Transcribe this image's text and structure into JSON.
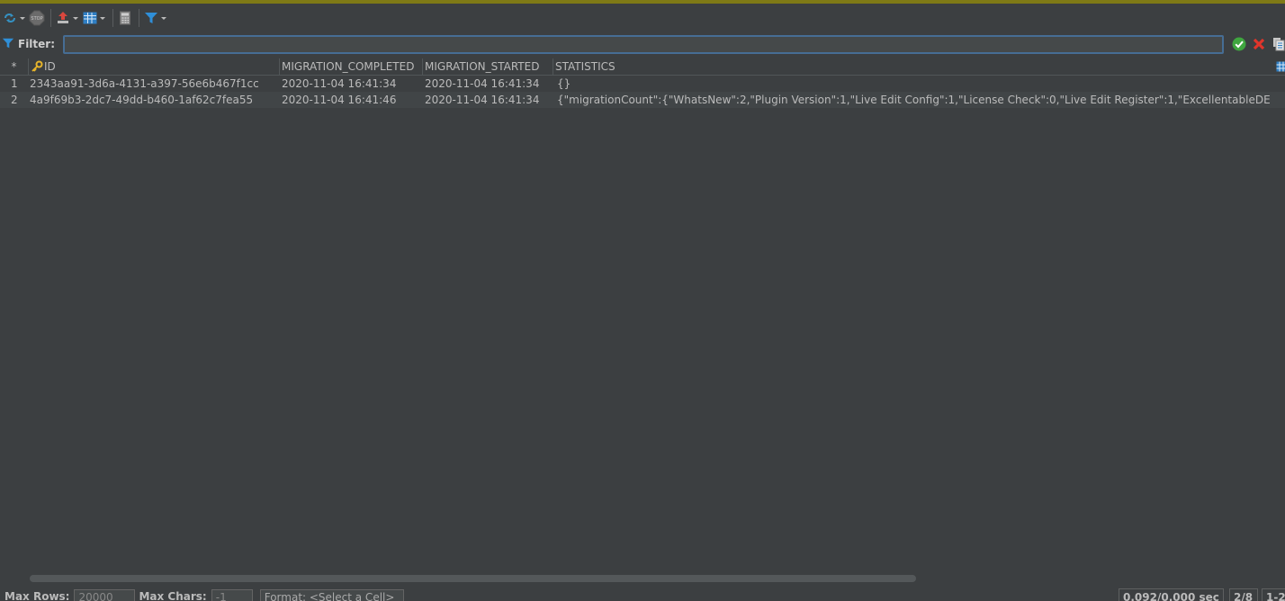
{
  "toolbar": {
    "icons": [
      "refresh-icon",
      "stop-icon",
      "export-icon",
      "grid-icon",
      "calculator-icon",
      "filter-icon"
    ],
    "stop_label": "STOP"
  },
  "filter": {
    "label": "Filter:",
    "value": "",
    "placeholder": ""
  },
  "table": {
    "corner": "*",
    "columns": [
      "ID",
      "MIGRATION_COMPLETED",
      "MIGRATION_STARTED",
      "STATISTICS"
    ],
    "rows": [
      {
        "num": "1",
        "id": "2343aa91-3d6a-4131-a397-56e6b467f1cc",
        "completed": "2020-11-04 16:41:34",
        "started": "2020-11-04 16:41:34",
        "statistics": "{}"
      },
      {
        "num": "2",
        "id": "4a9f69b3-2dc7-49dd-b460-1af62c7fea55",
        "completed": "2020-11-04 16:41:46",
        "started": "2020-11-04 16:41:34",
        "statistics": "{\"migrationCount\":{\"WhatsNew\":2,\"Plugin Version\":1,\"Live Edit Config\":1,\"License Check\":0,\"Live Edit Register\":1,\"ExcellentableDE"
      }
    ]
  },
  "status": {
    "max_rows_label": "Max Rows:",
    "max_rows_value": "20000",
    "max_chars_label": "Max Chars:",
    "max_chars_value": "-1",
    "format_label": "Format: <Select a Cell>",
    "timing": "0.092/0.000 sec",
    "fetched": "2/8",
    "range": "1-2"
  },
  "colors": {
    "accent": "#7f7a16",
    "background": "#3c3f41",
    "input_border": "#466d94"
  }
}
